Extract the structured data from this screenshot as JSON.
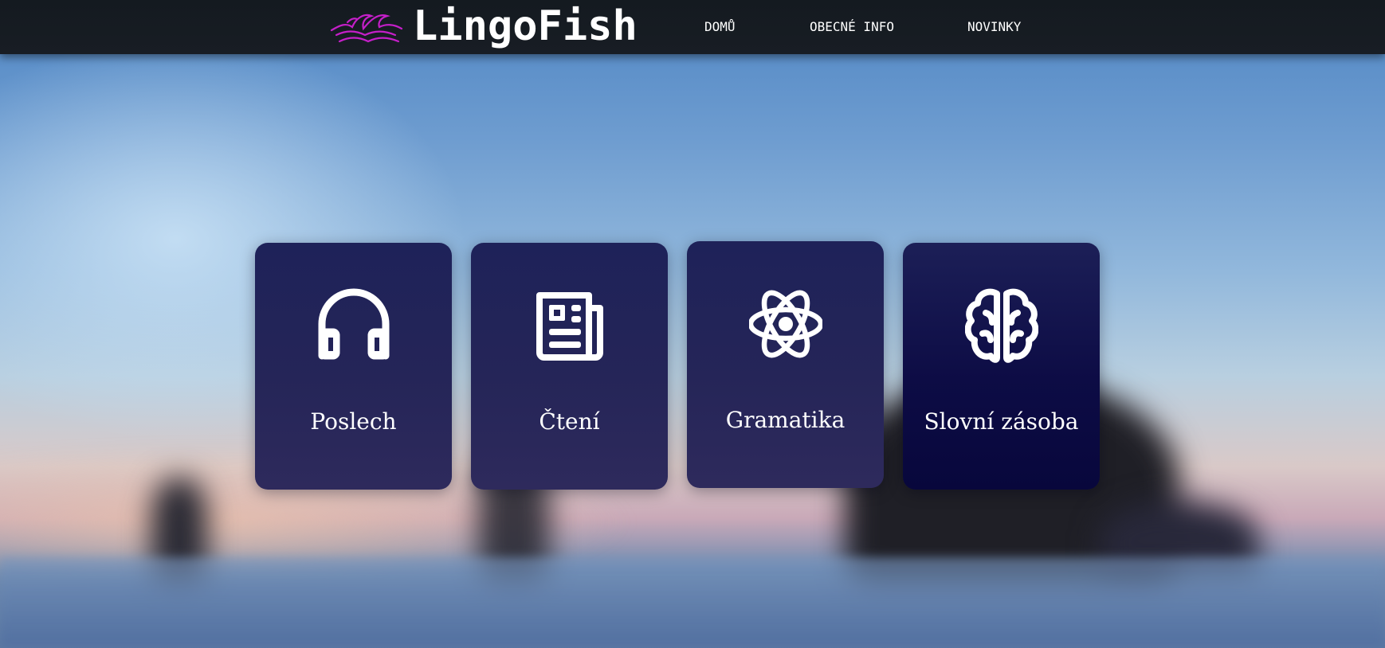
{
  "header": {
    "brand": "LingoFish",
    "brand_color": "#ffffff",
    "logo_color": "#c51fc9",
    "nav": [
      {
        "label": "DOMŮ"
      },
      {
        "label": "OBECNÉ INFO"
      },
      {
        "label": "NOVINKY"
      }
    ]
  },
  "cards": [
    {
      "label": "Poslech",
      "icon": "headphones-icon"
    },
    {
      "label": "Čtení",
      "icon": "newspaper-icon"
    },
    {
      "label": "Gramatika",
      "icon": "atom-icon"
    },
    {
      "label": "Slovní zásoba",
      "icon": "brain-icon"
    }
  ],
  "colors": {
    "card": "#232358",
    "card_highlight": "#0b0a40",
    "navbar": "#161b21"
  }
}
